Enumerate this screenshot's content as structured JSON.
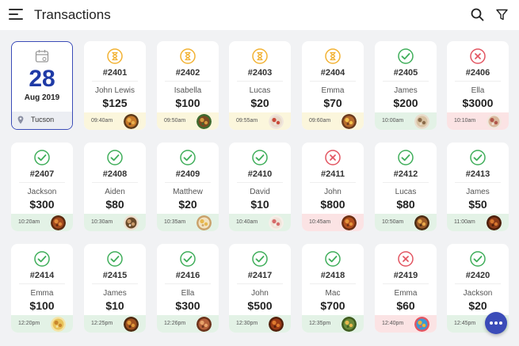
{
  "header": {
    "title": "Transactions",
    "menu_icon": "hamburger-menu-icon",
    "search_icon": "search-icon",
    "filter_icon": "filter-icon"
  },
  "date_card": {
    "day": "28",
    "month": "Aug 2019",
    "location": "Tucson",
    "icon": "calendar-icon",
    "pin_icon": "location-pin-icon"
  },
  "colors": {
    "accent": "#3b4cb8",
    "day_text": "#1f3aa6",
    "pending": "#f2b233",
    "done": "#3fae5a",
    "failed": "#e25561",
    "pending_bg": "#fbf6dc",
    "done_bg": "#e3f2e6",
    "failed_bg": "#fbe3e4"
  },
  "transactions": [
    {
      "id": "#2401",
      "name": "John Lewis",
      "amount": "$125",
      "time": "09:40am",
      "status": "pending",
      "food": "food-dish-icon"
    },
    {
      "id": "#2402",
      "name": "Isabella",
      "amount": "$100",
      "time": "09:50am",
      "status": "pending",
      "food": "food-dish-icon"
    },
    {
      "id": "#2403",
      "name": "Lucas",
      "amount": "$20",
      "time": "09:55am",
      "status": "pending",
      "food": "food-dish-icon"
    },
    {
      "id": "#2404",
      "name": "Emma",
      "amount": "$70",
      "time": "09:60am",
      "status": "pending",
      "food": "food-dish-icon"
    },
    {
      "id": "#2405",
      "name": "James",
      "amount": "$200",
      "time": "10:00am",
      "status": "done",
      "food": "food-dish-icon"
    },
    {
      "id": "#2406",
      "name": "Ella",
      "amount": "$3000",
      "time": "10:10am",
      "status": "failed",
      "food": "food-dish-icon"
    },
    {
      "id": "#2407",
      "name": "Jackson",
      "amount": "$300",
      "time": "10:20am",
      "status": "done",
      "food": "food-dish-icon"
    },
    {
      "id": "#2408",
      "name": "Aiden",
      "amount": "$80",
      "time": "10:30am",
      "status": "done",
      "food": "food-dish-icon"
    },
    {
      "id": "#2409",
      "name": "Matthew",
      "amount": "$20",
      "time": "10:35am",
      "status": "done",
      "food": "food-dish-icon"
    },
    {
      "id": "#2410",
      "name": "David",
      "amount": "$10",
      "time": "10:40am",
      "status": "done",
      "food": "food-dish-icon"
    },
    {
      "id": "#2411",
      "name": "John",
      "amount": "$800",
      "time": "10:45am",
      "status": "failed",
      "food": "food-dish-icon"
    },
    {
      "id": "#2412",
      "name": "Lucas",
      "amount": "$80",
      "time": "10:50am",
      "status": "done",
      "food": "food-dish-icon"
    },
    {
      "id": "#2413",
      "name": "James",
      "amount": "$50",
      "time": "11:00am",
      "status": "done",
      "food": "food-dish-icon"
    },
    {
      "id": "#2414",
      "name": "Emma",
      "amount": "$100",
      "time": "12:20pm",
      "status": "done",
      "food": "food-dish-icon"
    },
    {
      "id": "#2415",
      "name": "James",
      "amount": "$10",
      "time": "12:25pm",
      "status": "done",
      "food": "food-dish-icon"
    },
    {
      "id": "#2416",
      "name": "Ella",
      "amount": "$300",
      "time": "12:26pm",
      "status": "done",
      "food": "food-dish-icon"
    },
    {
      "id": "#2417",
      "name": "John",
      "amount": "$500",
      "time": "12:30pm",
      "status": "done",
      "food": "food-dish-icon"
    },
    {
      "id": "#2418",
      "name": "Mac",
      "amount": "$700",
      "time": "12:35pm",
      "status": "done",
      "food": "food-dish-icon"
    },
    {
      "id": "#2419",
      "name": "Emma",
      "amount": "$60",
      "time": "12:40pm",
      "status": "failed",
      "food": "food-dish-icon"
    },
    {
      "id": "#2420",
      "name": "Jackson",
      "amount": "$20",
      "time": "12:45pm",
      "status": "done",
      "food": "food-dish-icon"
    }
  ],
  "fab": {
    "icon": "more-dots-icon"
  }
}
